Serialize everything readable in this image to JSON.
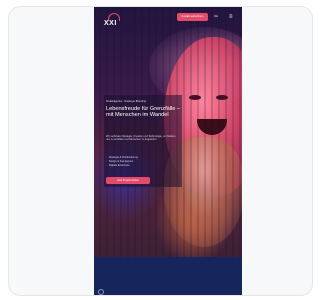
{
  "header": {
    "logo_text": "XXI",
    "cta_label": "Kontakt aufnehmen",
    "language_label": "DE",
    "menu_icon": "menu-icon"
  },
  "hero": {
    "eyebrow": "Kreativagentur · Employer Branding",
    "headline": "Lebensfreude für Grenzfälle – mit Menschen im Wandel",
    "body": "Wir verbinden Strategie, Kreation und Technologie, um Marken neu zu erzählen und Menschen zu begeistern.",
    "bullets": [
      "Strategie & Positionierung",
      "Design & Kampagnen",
      "Digitale Erlebnisse"
    ],
    "cta_label": "Jetzt Projekt starten"
  },
  "footer": {
    "icon": "chat-icon"
  },
  "colors": {
    "accent": "#e64a6b",
    "footer": "#16265c"
  }
}
